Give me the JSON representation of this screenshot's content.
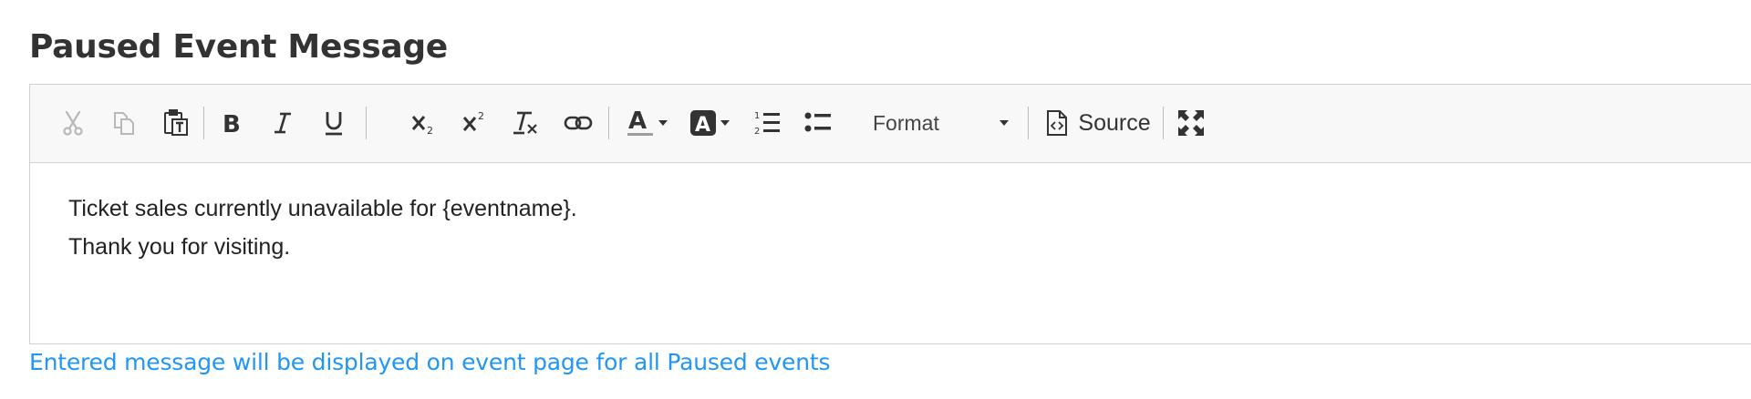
{
  "title": "Paused Event Message",
  "toolbar": {
    "format_label": "Format",
    "source_label": "Source",
    "buttons": [
      {
        "name": "cut",
        "icon": "scissors-icon",
        "enabled": false
      },
      {
        "name": "copy",
        "icon": "copy-icon",
        "enabled": false
      },
      {
        "name": "paste-as-text",
        "icon": "paste-text-icon",
        "enabled": true
      },
      {
        "name": "bold",
        "icon": "bold-icon",
        "enabled": true
      },
      {
        "name": "italic",
        "icon": "italic-icon",
        "enabled": true
      },
      {
        "name": "underline",
        "icon": "underline-icon",
        "enabled": true
      },
      {
        "name": "subscript",
        "icon": "subscript-icon",
        "enabled": true
      },
      {
        "name": "superscript",
        "icon": "superscript-icon",
        "enabled": true
      },
      {
        "name": "remove-format",
        "icon": "remove-format-icon",
        "enabled": true
      },
      {
        "name": "link",
        "icon": "link-icon",
        "enabled": true
      },
      {
        "name": "text-color",
        "icon": "text-color-icon",
        "enabled": true
      },
      {
        "name": "background-color",
        "icon": "background-color-icon",
        "enabled": true
      },
      {
        "name": "numbered-list",
        "icon": "numbered-list-icon",
        "enabled": true
      },
      {
        "name": "bulleted-list",
        "icon": "bulleted-list-icon",
        "enabled": true
      },
      {
        "name": "source",
        "icon": "source-icon",
        "enabled": true
      },
      {
        "name": "maximize",
        "icon": "maximize-icon",
        "enabled": true
      }
    ]
  },
  "content": {
    "lines": [
      "Ticket sales currently unavailable for {eventname}.",
      "Thank you for visiting."
    ]
  },
  "hint": "Entered message will be displayed on event page for all Paused events",
  "colors": {
    "hint": "#2196f3",
    "toolbar_bg": "#f8f8f8",
    "border": "#d1d1d1",
    "disabled_icon": "#b8b8b8"
  }
}
